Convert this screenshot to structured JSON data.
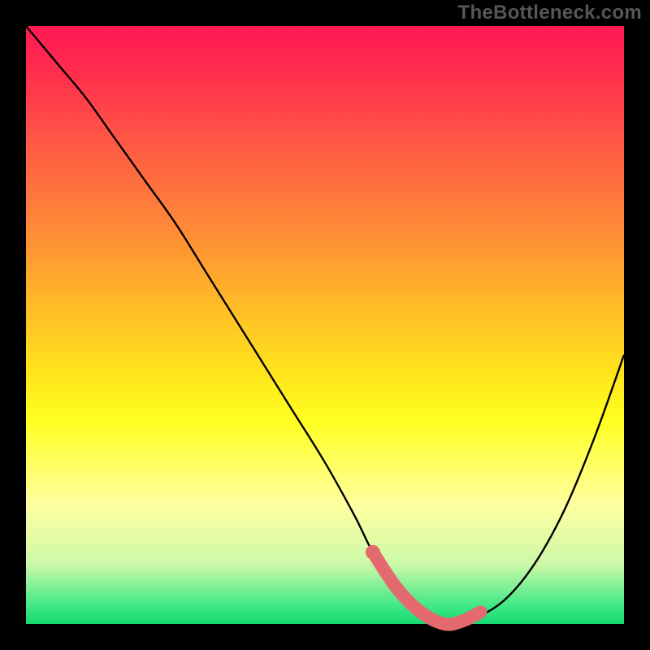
{
  "watermark": "TheBottleneck.com",
  "chart_data": {
    "type": "line",
    "title": "",
    "xlabel": "",
    "ylabel": "",
    "xlim": [
      0,
      100
    ],
    "ylim": [
      0,
      100
    ],
    "grid": false,
    "legend": false,
    "series": [
      {
        "name": "bottleneck-curve",
        "x": [
          0,
          5,
          10,
          15,
          20,
          25,
          30,
          35,
          40,
          45,
          50,
          55,
          58,
          62,
          66,
          70,
          75,
          80,
          85,
          90,
          95,
          100
        ],
        "y": [
          100,
          94,
          88,
          81,
          74,
          67,
          59,
          51,
          43,
          35,
          27,
          18,
          12,
          6,
          2,
          0,
          1,
          4,
          10,
          19,
          31,
          45
        ]
      }
    ],
    "highlight": {
      "name": "optimal-range",
      "x": [
        58,
        62,
        66,
        70,
        73,
        76
      ],
      "y": [
        12,
        6,
        2,
        0,
        0.5,
        2
      ]
    },
    "gradient_stops": [
      {
        "pos": 0.0,
        "color": "#ff1954"
      },
      {
        "pos": 0.34,
        "color": "#ff8a36"
      },
      {
        "pos": 0.66,
        "color": "#ffff20"
      },
      {
        "pos": 0.9,
        "color": "#ccf9a8"
      },
      {
        "pos": 1.0,
        "color": "#15d870"
      }
    ]
  }
}
